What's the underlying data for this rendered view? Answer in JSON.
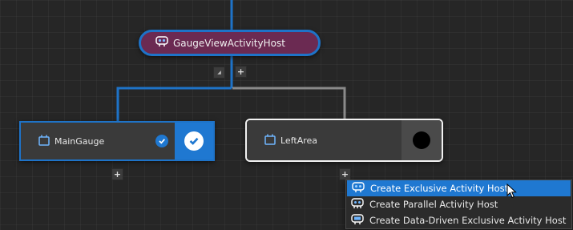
{
  "canvas": {
    "colors": {
      "background": "#262626",
      "connector_blue": "#1e73c8",
      "connector_gray": "#8a8a8a",
      "accent": "#1f78d1",
      "root_fill": "#6b2a52"
    }
  },
  "root_node": {
    "label": "GaugeViewActivityHost",
    "icon": "activity-host-icon"
  },
  "collapse_button": {
    "glyph": "◢"
  },
  "add_child_button": {
    "glyph": "+"
  },
  "children": [
    {
      "label": "MainGauge",
      "icon": "screen-icon",
      "state": "selected",
      "add_glyph": "+"
    },
    {
      "label": "LeftArea",
      "icon": "screen-icon",
      "state": "outlined",
      "add_glyph": "+"
    }
  ],
  "context_menu": {
    "items": [
      {
        "label": "Create Exclusive Activity Host",
        "icon": "exclusive-host-icon",
        "highlighted": true
      },
      {
        "label": "Create Parallel Activity Host",
        "icon": "parallel-host-icon",
        "highlighted": false
      },
      {
        "label": "Create Data-Driven Exclusive Activity Host",
        "icon": "data-driven-host-icon",
        "highlighted": false
      }
    ]
  }
}
